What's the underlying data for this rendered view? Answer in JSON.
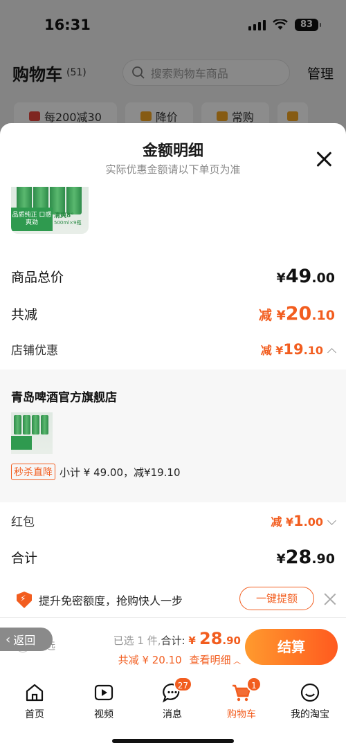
{
  "status_bar": {
    "time": "16:31",
    "battery": "83"
  },
  "cart_header": {
    "title": "购物车",
    "count": "(51)",
    "search_placeholder": "搜索购物车商品",
    "manage": "管理",
    "chips": [
      "每200减30",
      "降价",
      "常购"
    ]
  },
  "sheet": {
    "title": "金额明细",
    "subtitle": "实际优惠金额请以下单页为准",
    "product_image_text": {
      "band": "品质纯正 口感爽劲",
      "tag": "清爽8°",
      "volume": "500ml×9瓶"
    },
    "total_price": {
      "label": "商品总价",
      "currency": "¥",
      "int": "49",
      "dec": ".00"
    },
    "total_discount": {
      "label": "共减",
      "prefix": "减 ¥",
      "int": "20",
      "dec": ".10"
    },
    "store_discount": {
      "label": "店铺优惠",
      "prefix": "减 ¥",
      "int": "19",
      "dec": ".10"
    },
    "store": {
      "name": "青岛啤酒官方旗舰店",
      "tag": "秒杀直降",
      "subtotal": "小计 ¥ 49.00，减¥19.10"
    },
    "red_packet": {
      "label": "红包",
      "prefix": "减 ¥",
      "int": "1",
      "dec": ".00"
    },
    "sum": {
      "label": "合计",
      "currency": "¥",
      "int": "28",
      "dec": ".90"
    }
  },
  "promo": {
    "text": "提升免密额度，抢购快人一步",
    "button": "一键提额"
  },
  "checkout": {
    "back": "返回",
    "select_all": "全选",
    "selected": "已选 1 件,",
    "total_label": "合计:",
    "total_currency": "¥",
    "total_int": "28",
    "total_dec": ".90",
    "discount_text": "共减 ¥ 20.10",
    "detail_link": "查看明细",
    "pay": "结算"
  },
  "tabbar": [
    {
      "label": "首页",
      "icon": "home-icon"
    },
    {
      "label": "视频",
      "icon": "video-icon"
    },
    {
      "label": "消息",
      "icon": "message-icon",
      "badge": "27"
    },
    {
      "label": "购物车",
      "icon": "cart-icon",
      "badge": "1",
      "active": true
    },
    {
      "label": "我的淘宝",
      "icon": "profile-icon"
    }
  ],
  "colors": {
    "accent": "#f25d1f",
    "pay_gradient_start": "#ff9a2e",
    "pay_gradient_end": "#ff5a1f",
    "overlay": "rgba(0,0,0,0.45)"
  }
}
